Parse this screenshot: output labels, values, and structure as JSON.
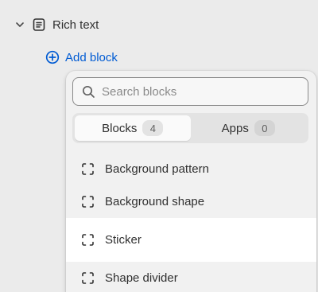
{
  "tree": {
    "section_label": "Rich text",
    "chevron_icon": "chevron-down-icon",
    "section_icon": "text-block-icon"
  },
  "add_block": {
    "label": "Add block",
    "icon": "plus-circle-icon",
    "color": "#005bd3"
  },
  "popover": {
    "search": {
      "placeholder": "Search blocks",
      "value": ""
    },
    "tabs": [
      {
        "label": "Blocks",
        "count": "4",
        "selected": true
      },
      {
        "label": "Apps",
        "count": "0",
        "selected": false
      }
    ],
    "items": [
      {
        "label": "Background pattern",
        "icon": "block-outline-icon"
      },
      {
        "label": "Background shape",
        "icon": "block-outline-icon"
      },
      {
        "label": "Sticker",
        "icon": "block-outline-icon",
        "hovered": true
      },
      {
        "label": "Shape divider",
        "icon": "block-outline-icon"
      }
    ]
  }
}
